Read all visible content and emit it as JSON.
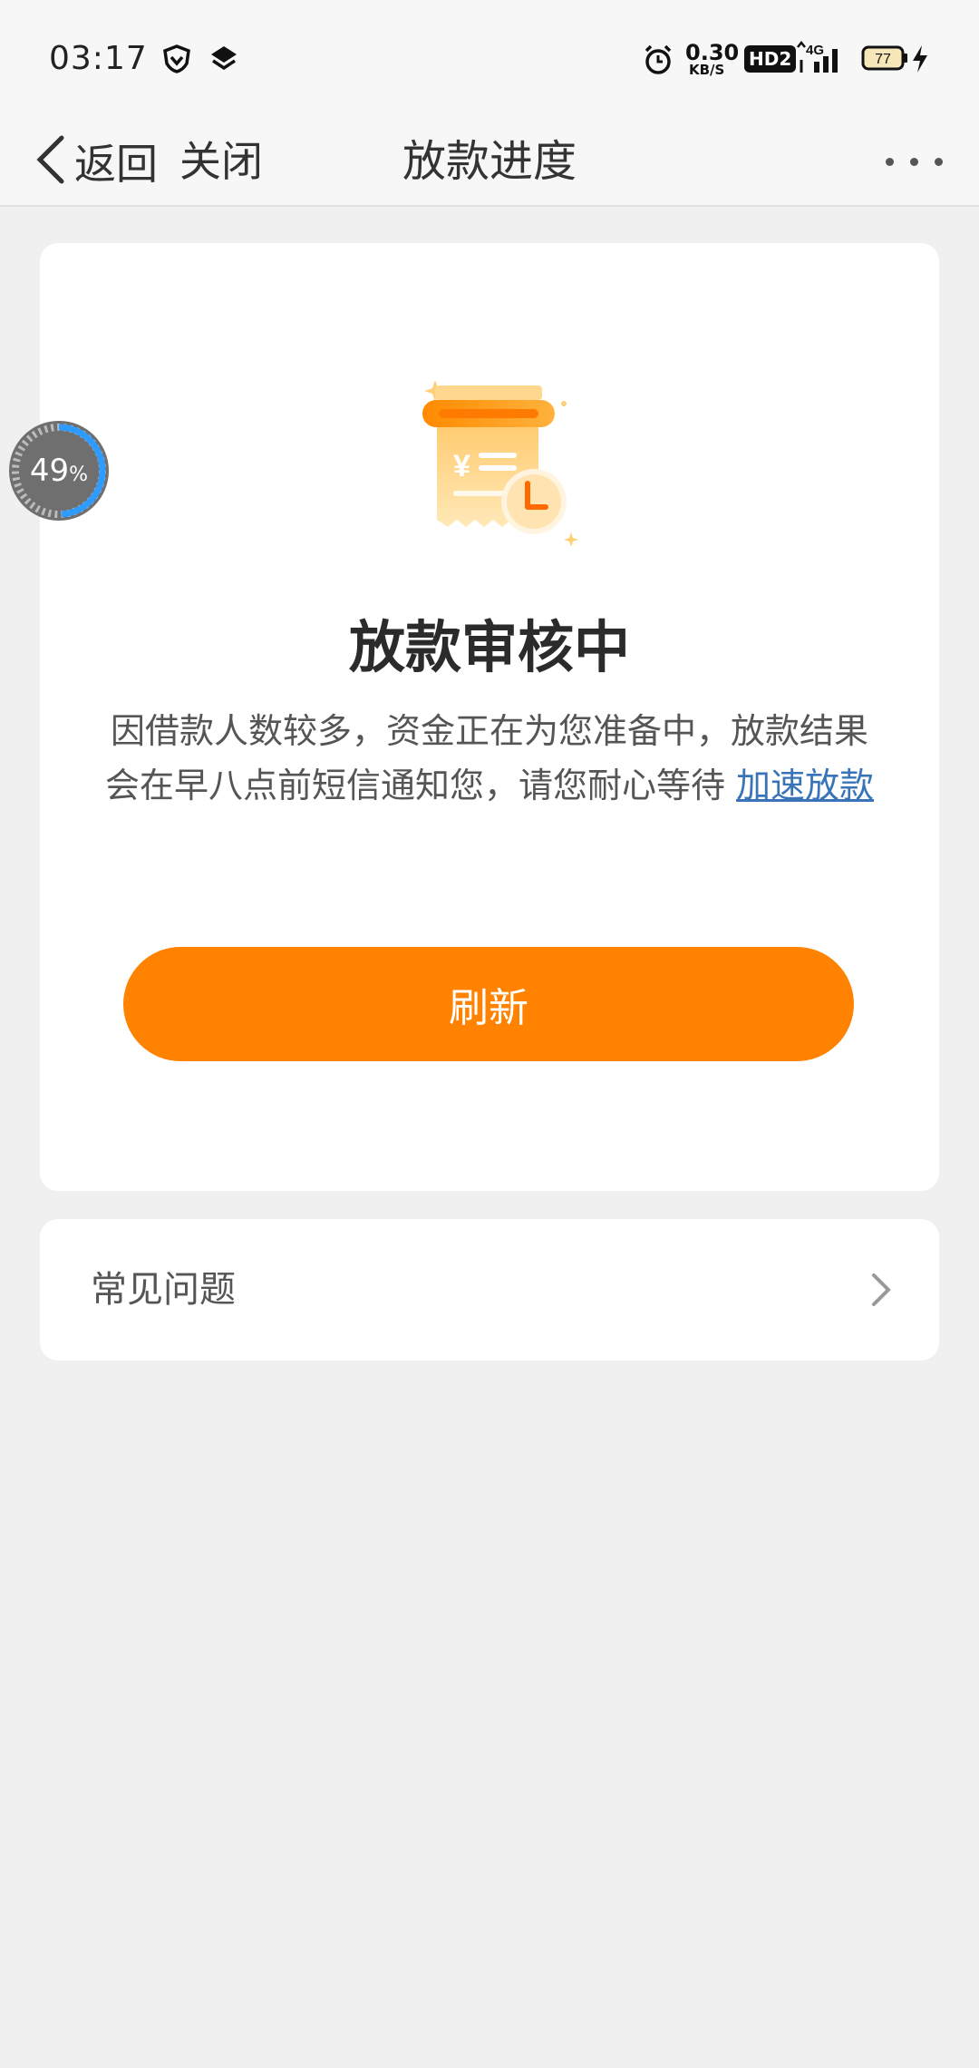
{
  "status_bar": {
    "time": "03:17",
    "net_speed_value": "0.30",
    "net_speed_unit": "KB/S",
    "hd_label": "HD2",
    "network_label": "4G",
    "battery": "77",
    "icons": [
      "shield-icon",
      "layers-icon",
      "alarm-icon",
      "hd-icon",
      "signal-icon",
      "battery-icon",
      "charging-icon"
    ]
  },
  "nav": {
    "back_label": "返回",
    "close_label": "关闭",
    "title": "放款进度",
    "more_icon": "more-dots-icon"
  },
  "status_card": {
    "illustration_icon": "receipt-clock-icon",
    "title": "放款审核中",
    "description": "因借款人数较多，资金正在为您准备中，放款结果会在早八点前短信通知您，请您耐心等待",
    "link_text": "加速放款",
    "refresh_label": "刷新"
  },
  "faq": {
    "label": "常见问题",
    "chevron_icon": "chevron-right-icon"
  },
  "progress_bubble": {
    "value": 49,
    "value_text": "49",
    "unit": "%"
  },
  "colors": {
    "accent": "#ff8200",
    "link": "#3a74b8",
    "page_bg": "#f0f0f0"
  }
}
